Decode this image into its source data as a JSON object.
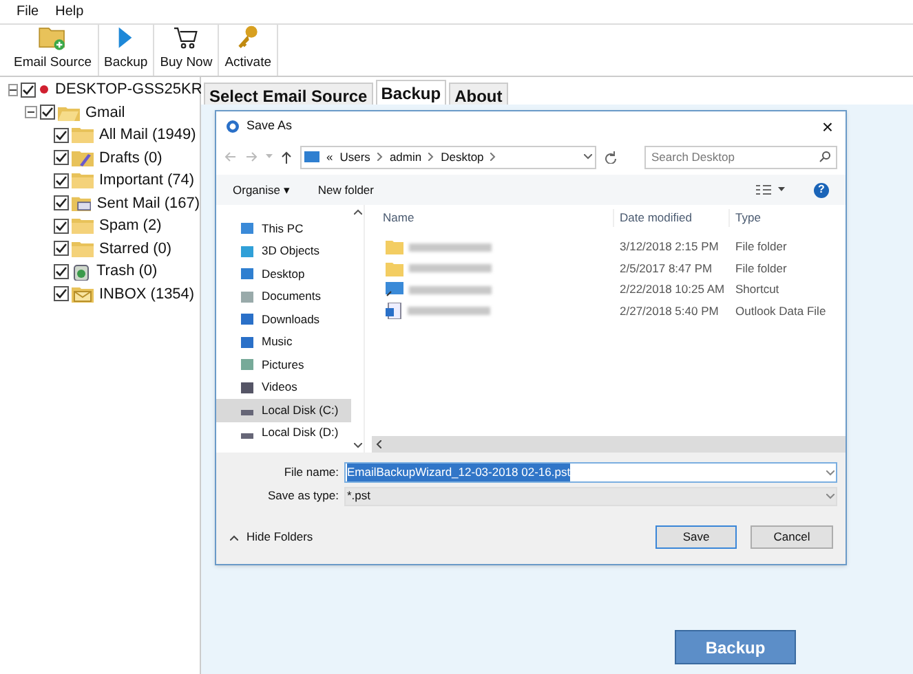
{
  "menu": [
    "File",
    "Help"
  ],
  "toolbar": [
    {
      "kind": "source",
      "label": "Email Source"
    },
    {
      "kind": "backup",
      "label": "Backup"
    },
    {
      "kind": "cart",
      "label": "Buy Now"
    },
    {
      "kind": "key",
      "label": "Activate"
    }
  ],
  "tree": [
    {
      "label": "DESKTOP-GSS25KR",
      "checked": true,
      "expanded": true,
      "children": [
        {
          "label": "Gmail",
          "checked": true,
          "expanded": true,
          "children": [
            {
              "label": "All Mail (1949)",
              "checked": true
            },
            {
              "label": "Drafts (0)",
              "checked": true
            },
            {
              "label": "Important (74)",
              "checked": true
            },
            {
              "label": "Sent Mail (167)",
              "checked": true
            },
            {
              "label": "Spam (2)",
              "checked": true
            },
            {
              "label": "Starred (0)",
              "checked": true
            },
            {
              "label": "Trash (0)",
              "checked": true
            },
            {
              "label": "INBOX (1354)",
              "checked": true
            }
          ]
        }
      ]
    }
  ],
  "tabs": [
    {
      "label": "Select Email Source",
      "selected": false
    },
    {
      "label": "Backup",
      "selected": true
    },
    {
      "label": "About",
      "selected": false
    }
  ],
  "dialog": {
    "title": "Save As",
    "close": "×",
    "breadcrumb": [
      "«",
      "Users",
      "admin",
      "Desktop"
    ],
    "search": {
      "placeholder": "Search Desktop"
    },
    "commands": [
      "Organise ▾",
      "New folder"
    ],
    "help": "?",
    "nav": [
      {
        "label": "This PC",
        "selected": false
      },
      {
        "label": "3D Objects",
        "selected": false
      },
      {
        "label": "Desktop",
        "selected": false
      },
      {
        "label": "Documents",
        "selected": false
      },
      {
        "label": "Downloads",
        "selected": false
      },
      {
        "label": "Music",
        "selected": false
      },
      {
        "label": "Pictures",
        "selected": false
      },
      {
        "label": "Videos",
        "selected": false
      },
      {
        "label": "Local Disk (C:)",
        "selected": true
      },
      {
        "label": "Local Disk (D:)",
        "selected": false
      }
    ],
    "columns": [
      "Name",
      "Date modified",
      "Type"
    ],
    "files": [
      {
        "date": "3/12/2018 2:15 PM",
        "type": "File folder"
      },
      {
        "date": "2/5/2017 8:47 PM",
        "type": "File folder"
      },
      {
        "date": "2/22/2018 10:25 AM",
        "type": "Shortcut"
      },
      {
        "date": "2/27/2018 5:40 PM",
        "type": "Outlook Data File"
      }
    ],
    "file_name_label": "File name:",
    "file_name": "EmailBackupWizard_12-03-2018 02-16.pst",
    "type_label": "Save as type:",
    "type_value": "*.pst",
    "hide_folders": "Hide Folders",
    "save": "Save",
    "cancel": "Cancel"
  },
  "backup_button": "Backup"
}
